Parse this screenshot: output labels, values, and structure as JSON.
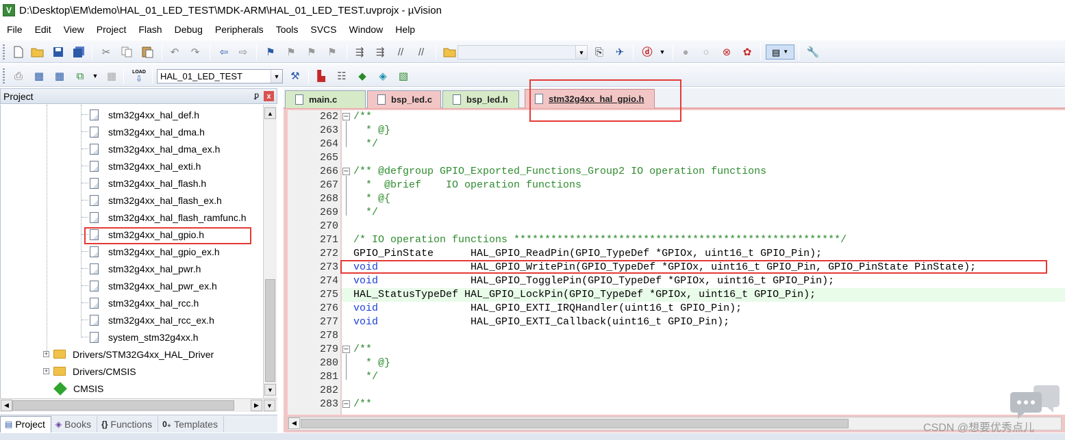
{
  "window": {
    "title": "D:\\Desktop\\EM\\demo\\HAL_01_LED_TEST\\MDK-ARM\\HAL_01_LED_TEST.uvprojx - µVision",
    "app_icon_letter": "V"
  },
  "menu": [
    "File",
    "Edit",
    "View",
    "Project",
    "Flash",
    "Debug",
    "Peripherals",
    "Tools",
    "SVCS",
    "Window",
    "Help"
  ],
  "toolbar": {
    "target_combo": "HAL_01_LED_TEST",
    "load_label": "LOAD"
  },
  "project_panel": {
    "title": "Project",
    "pin": "ᵱ",
    "close": "x",
    "files": [
      "stm32g4xx_hal_def.h",
      "stm32g4xx_hal_dma.h",
      "stm32g4xx_hal_dma_ex.h",
      "stm32g4xx_hal_exti.h",
      "stm32g4xx_hal_flash.h",
      "stm32g4xx_hal_flash_ex.h",
      "stm32g4xx_hal_flash_ramfunc.h",
      "stm32g4xx_hal_gpio.h",
      "stm32g4xx_hal_gpio_ex.h",
      "stm32g4xx_hal_pwr.h",
      "stm32g4xx_hal_pwr_ex.h",
      "stm32g4xx_hal_rcc.h",
      "stm32g4xx_hal_rcc_ex.h",
      "system_stm32g4xx.h"
    ],
    "groups": [
      "Drivers/STM32G4xx_HAL_Driver",
      "Drivers/CMSIS"
    ],
    "component": "CMSIS",
    "tabs": [
      "Project",
      "Books",
      "Functions",
      "Templates"
    ],
    "tab_icons": [
      "▤",
      "◈",
      "{}",
      "0₊"
    ]
  },
  "editor": {
    "tabs": [
      "main.c",
      "bsp_led.c",
      "bsp_led.h",
      "stm32g4xx_hal_gpio.h"
    ],
    "lines": [
      {
        "n": "262",
        "t": "/**"
      },
      {
        "n": "263",
        "t": "  * @}"
      },
      {
        "n": "264",
        "t": "  */"
      },
      {
        "n": "265",
        "t": ""
      },
      {
        "n": "266",
        "t": "/** @defgroup GPIO_Exported_Functions_Group2 IO operation functions"
      },
      {
        "n": "267",
        "t": "  *  @brief    IO operation functions"
      },
      {
        "n": "268",
        "t": "  * @{"
      },
      {
        "n": "269",
        "t": "  */"
      },
      {
        "n": "270",
        "t": ""
      },
      {
        "n": "271",
        "t": "/* IO operation functions *****************************************************/"
      },
      {
        "n": "272",
        "kw": "GPIO_PinState",
        "t": "      HAL_GPIO_ReadPin(GPIO_TypeDef *GPIOx, uint16_t GPIO_Pin);"
      },
      {
        "n": "273",
        "kw": "void",
        "t": "               HAL_GPIO_WritePin(GPIO_TypeDef *GPIOx, uint16_t GPIO_Pin, GPIO_PinState PinState);"
      },
      {
        "n": "274",
        "kw": "void",
        "t": "               HAL_GPIO_TogglePin(GPIO_TypeDef *GPIOx, uint16_t GPIO_Pin);"
      },
      {
        "n": "275",
        "kw": "HAL_StatusTypeDef",
        "t": " HAL_GPIO_LockPin(GPIO_TypeDef *GPIOx, uint16_t GPIO_Pin);"
      },
      {
        "n": "276",
        "kw": "void",
        "t": "               HAL_GPIO_EXTI_IRQHandler(uint16_t GPIO_Pin);"
      },
      {
        "n": "277",
        "kw": "void",
        "t": "               HAL_GPIO_EXTI_Callback(uint16_t GPIO_Pin);"
      },
      {
        "n": "278",
        "t": ""
      },
      {
        "n": "279",
        "t": "/**"
      },
      {
        "n": "280",
        "t": "  * @}"
      },
      {
        "n": "281",
        "t": "  */"
      },
      {
        "n": "282",
        "t": ""
      },
      {
        "n": "283",
        "t": "/**"
      }
    ]
  },
  "watermark": "CSDN @想要优秀点儿",
  "colors": {
    "comment": "#2e8b2e",
    "keyword": "#1a3fd6",
    "annotation": "#e53935",
    "active_tab": "#f3c6c6",
    "inactive_tab": "#d7eac8"
  }
}
